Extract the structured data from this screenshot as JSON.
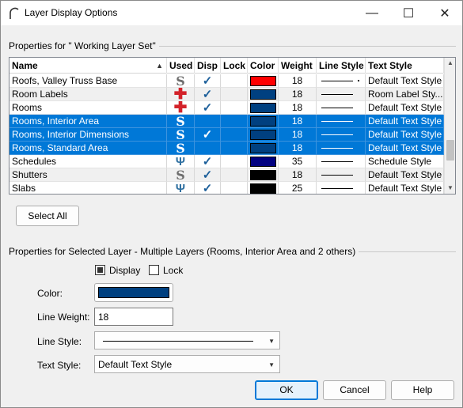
{
  "window": {
    "title": "Layer Display Options"
  },
  "layer_set": {
    "group_label": "Properties for \" Working Layer Set\""
  },
  "grid": {
    "columns": [
      "Name",
      "Used",
      "Disp",
      "Lock",
      "Color",
      "Weight",
      "Line Style",
      "Text Style"
    ],
    "rows": [
      {
        "name": "Roofs, Valley Truss Base",
        "used": "S",
        "used_icon": "s-icon",
        "disp": "✓",
        "lock": "",
        "color": "#ff0000",
        "weight": "18",
        "text_style": "Default Text Style",
        "selected": false,
        "alt": false
      },
      {
        "name": "Room Labels",
        "used": "✚",
        "used_icon": "red-cross-icon",
        "disp": "✓",
        "lock": "",
        "color": "#004080",
        "weight": "18",
        "text_style": "Room Label Sty...",
        "selected": false,
        "alt": true
      },
      {
        "name": "Rooms",
        "used": "✚",
        "used_icon": "red-cross-icon",
        "disp": "✓",
        "lock": "",
        "color": "#004080",
        "weight": "18",
        "text_style": "Default Text Style",
        "selected": false,
        "alt": false
      },
      {
        "name": "Rooms, Interior Area",
        "used": "S",
        "used_icon": "s-icon",
        "disp": "",
        "lock": "",
        "color": "#004080",
        "weight": "18",
        "text_style": "Default Text Style",
        "selected": true,
        "alt": false
      },
      {
        "name": "Rooms, Interior Dimensions",
        "used": "S",
        "used_icon": "s-icon",
        "disp": "✓",
        "lock": "",
        "color": "#004080",
        "weight": "18",
        "text_style": "Default Text Style",
        "selected": true,
        "alt": false
      },
      {
        "name": "Rooms, Standard Area",
        "used": "S",
        "used_icon": "s-icon",
        "disp": "",
        "lock": "",
        "color": "#004080",
        "weight": "18",
        "text_style": "Default Text Style",
        "selected": true,
        "alt": false
      },
      {
        "name": "Schedules",
        "used": "Ψ",
        "used_icon": "hook-icon",
        "disp": "✓",
        "lock": "",
        "color": "#000080",
        "weight": "35",
        "text_style": "Schedule Style",
        "selected": false,
        "alt": false
      },
      {
        "name": "Shutters",
        "used": "S",
        "used_icon": "s-icon",
        "disp": "✓",
        "lock": "",
        "color": "#000000",
        "weight": "18",
        "text_style": "Default Text Style",
        "selected": false,
        "alt": true
      },
      {
        "name": "Slabs",
        "used": "Ψ",
        "used_icon": "hook-icon",
        "disp": "✓",
        "lock": "",
        "color": "#000000",
        "weight": "25",
        "text_style": "Default Text Style",
        "selected": false,
        "alt": false
      }
    ]
  },
  "select_all_label": "Select All",
  "selected_props": {
    "group_label": "Properties for Selected Layer - Multiple Layers (Rooms, Interior Area and 2 others)",
    "display_label": "Display",
    "lock_label": "Lock",
    "color_label": "Color:",
    "color_value": "#004080",
    "line_weight_label": "Line Weight:",
    "line_weight_value": "18",
    "line_style_label": "Line Style:",
    "text_style_label": "Text Style:",
    "text_style_value": "Default Text Style"
  },
  "buttons": {
    "ok": "OK",
    "cancel": "Cancel",
    "help": "Help"
  },
  "titlebar": {
    "minimize": "—",
    "maximize": "☐",
    "close": "✕"
  }
}
